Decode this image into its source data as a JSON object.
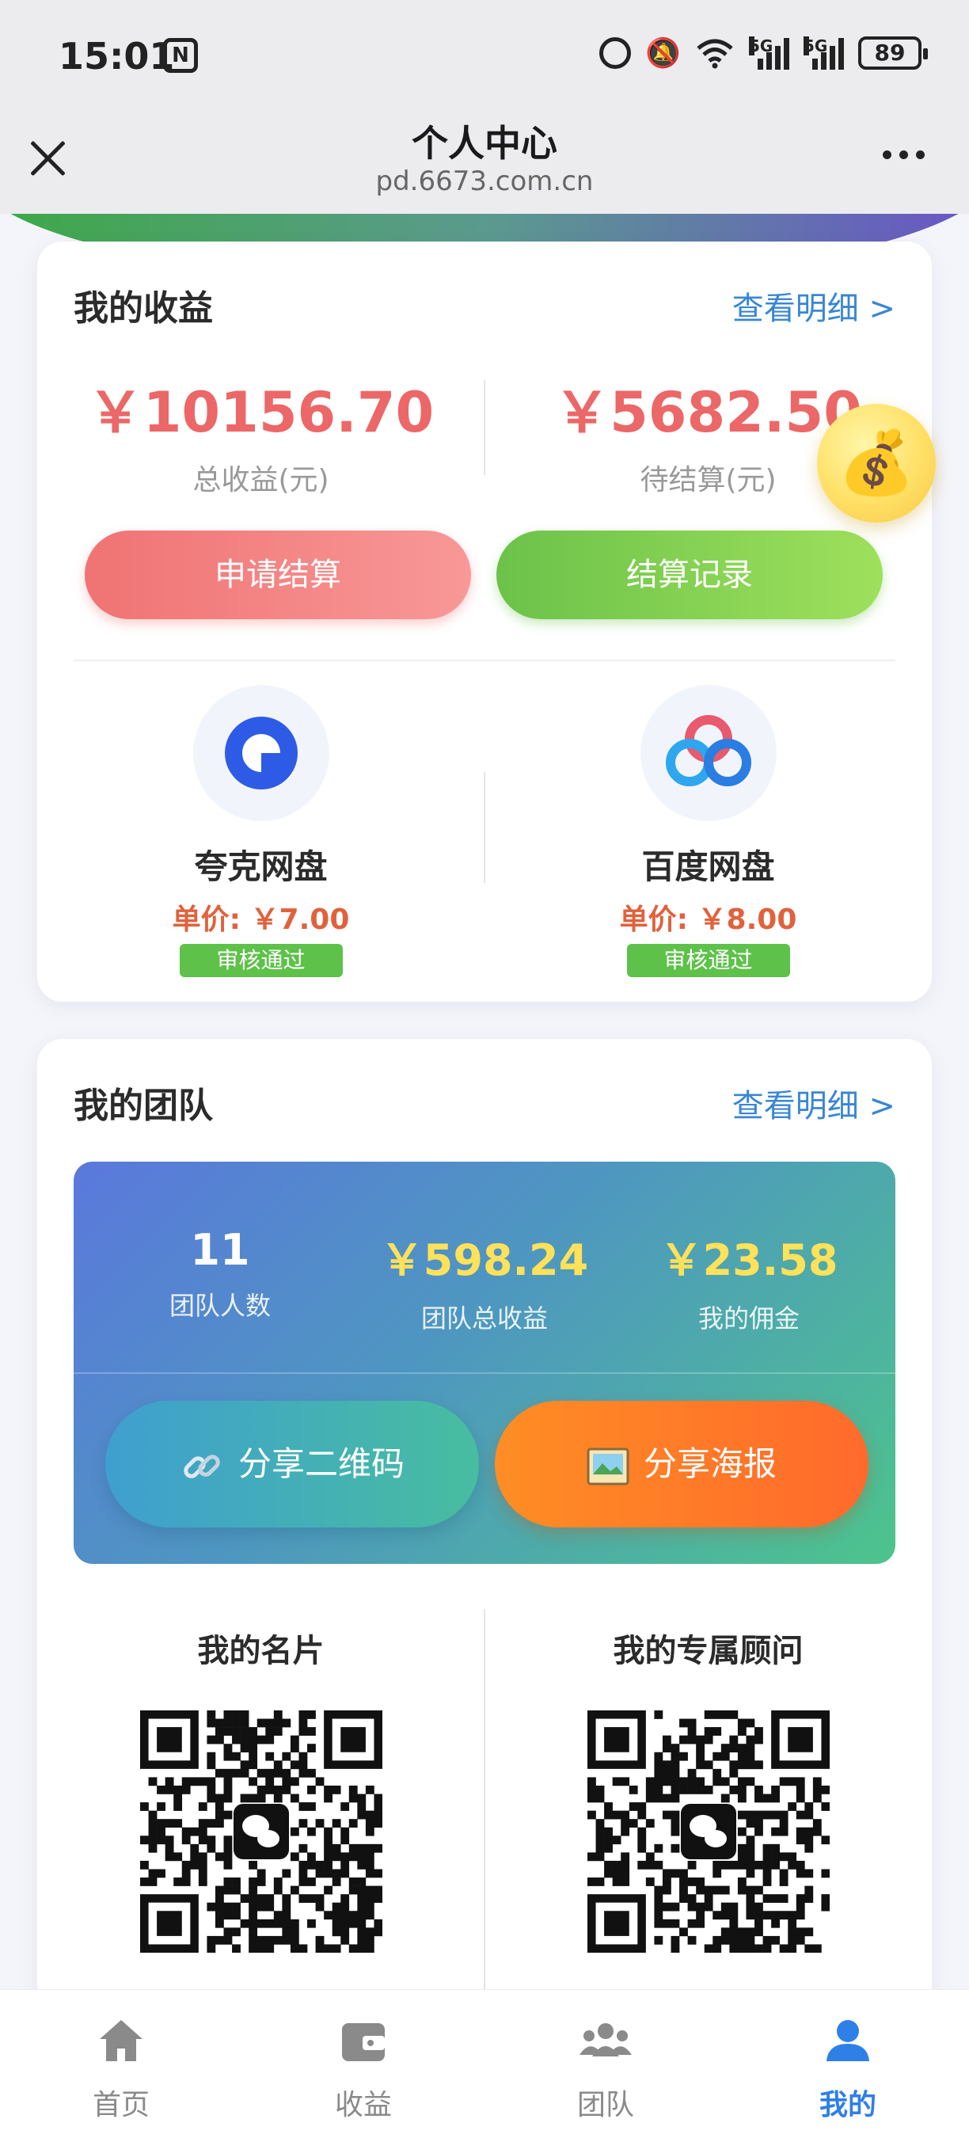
{
  "status_bar": {
    "time": "15:01",
    "battery": "89",
    "network_1": "5G",
    "network_2": "5G"
  },
  "title_bar": {
    "title": "个人中心",
    "url": "pd.6673.com.cn"
  },
  "earnings": {
    "title": "我的收益",
    "detail_link": "查看明细 >",
    "total_amount": "￥10156.70",
    "total_label": "总收益(元)",
    "pending_amount": "￥5682.50",
    "pending_label": "待结算(元)",
    "apply_button": "申请结算",
    "records_button": "结算记录",
    "disks": [
      {
        "name": "夸克网盘",
        "price": "单价: ￥7.00",
        "status": "审核通过",
        "icon": "quark-icon"
      },
      {
        "name": "百度网盘",
        "price": "单价: ￥8.00",
        "status": "审核通过",
        "icon": "baidu-cloud-icon"
      }
    ]
  },
  "team": {
    "title": "我的团队",
    "detail_link": "查看明细 >",
    "stats": [
      {
        "value": "11",
        "label": "团队人数"
      },
      {
        "value": "￥598.24",
        "label": "团队总收益"
      },
      {
        "value": "￥23.58",
        "label": "我的佣金"
      }
    ],
    "share_qr_button": "分享二维码",
    "share_poster_button": "分享海报",
    "card_title": "我的名片",
    "advisor_title": "我的专属顾问"
  },
  "tabbar": {
    "items": [
      {
        "label": "首页",
        "icon": "home-icon",
        "active": false
      },
      {
        "label": "收益",
        "icon": "wallet-icon",
        "active": false
      },
      {
        "label": "团队",
        "icon": "team-icon",
        "active": false
      },
      {
        "label": "我的",
        "icon": "user-icon",
        "active": true
      }
    ]
  },
  "colors": {
    "accent_blue": "#2f7fe8",
    "amount_red": "#ec6767",
    "badge_green": "#5ec14a",
    "stat_yellow": "#ffe15a"
  }
}
